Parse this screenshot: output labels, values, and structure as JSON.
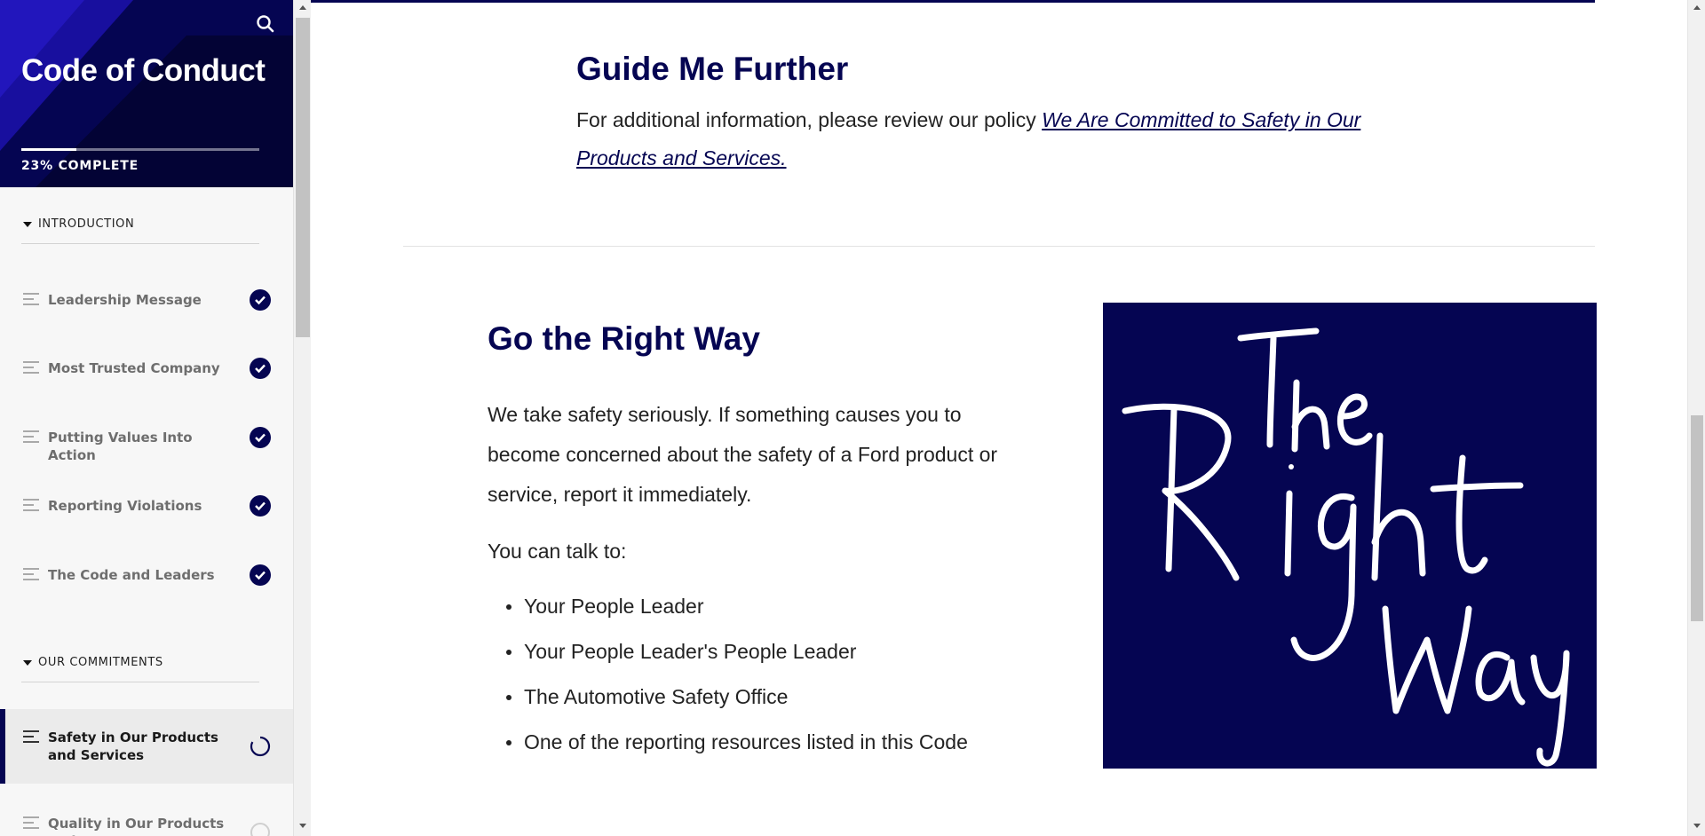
{
  "sidebar": {
    "course_title": "Code of Conduct",
    "progress": {
      "percent": 23,
      "label": "23% COMPLETE"
    },
    "search_icon": "search-icon",
    "sections": [
      {
        "label": "INTRODUCTION",
        "lessons": [
          {
            "title": "Leadership Message",
            "status": "complete"
          },
          {
            "title": "Most Trusted Company",
            "status": "complete"
          },
          {
            "title": "Putting Values Into Action",
            "status": "complete"
          },
          {
            "title": "Reporting Violations",
            "status": "complete"
          },
          {
            "title": "The Code and Leaders",
            "status": "complete"
          }
        ]
      },
      {
        "label": "OUR COMMITMENTS",
        "lessons": [
          {
            "title": "Safety in Our Products and Services",
            "status": "in-progress",
            "active": true
          },
          {
            "title": "Quality in Our Products and",
            "status": "not-started"
          }
        ]
      }
    ]
  },
  "main": {
    "guide": {
      "title": "Guide Me Further",
      "body": "For additional information, please review our policy ",
      "link": "We Are Committed to Safety in Our Products and Services."
    },
    "go": {
      "title": "Go the Right Way",
      "body": "We take safety seriously. If something causes you to become concerned about the safety of a Ford product or service, report it immediately.",
      "talk_label": "You can talk to:",
      "talk_list": [
        "Your People Leader",
        "Your People Leader's People Leader",
        "The Automotive Safety Office",
        "One of the reporting resources listed in this Code"
      ]
    },
    "image": {
      "logo_text": "The Right Way",
      "background": "#050552",
      "text_color": "#ffffff"
    }
  },
  "colors": {
    "brand_navy": "#050552",
    "sidebar_bg": "#f7f7f7",
    "muted_text": "#6e6e6e"
  }
}
